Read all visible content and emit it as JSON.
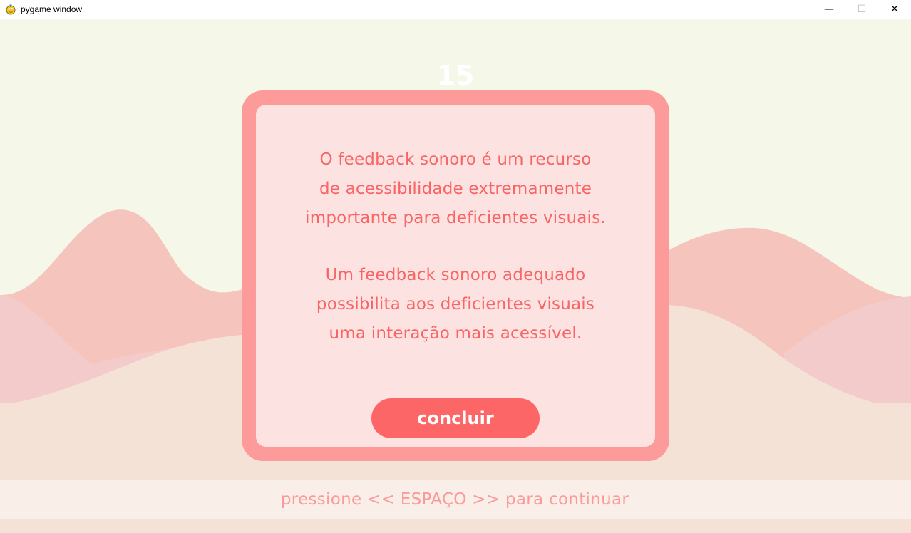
{
  "window": {
    "title": "pygame window",
    "controls": {
      "minimize": "—",
      "maximize": "☐",
      "close": "✕"
    }
  },
  "game": {
    "score": "15",
    "dialog": {
      "paragraph1": [
        "O feedback sonoro é um recurso",
        "de acessibilidade extremamente",
        "importante para deficientes visuais."
      ],
      "paragraph2": [
        "Um feedback sonoro adequado",
        "possibilita aos deficientes visuais",
        "uma interação mais acessível."
      ],
      "button_label": "concluir"
    },
    "hint": "pressione << ESPAÇO >> para continuar"
  },
  "colors": {
    "sky": "#f5f7e8",
    "dialog_border": "#fd9a9a",
    "dialog_fill": "#fde2e2",
    "dialog_text": "#f96464",
    "button": "#fd6666",
    "hint_text": "#fb9a9a"
  }
}
